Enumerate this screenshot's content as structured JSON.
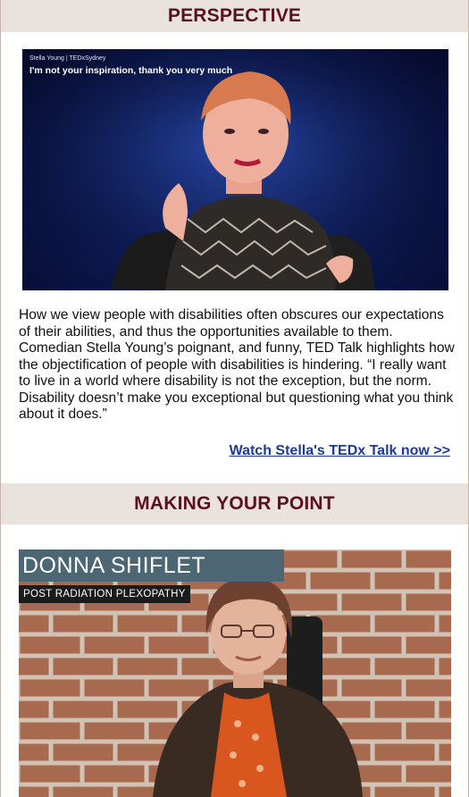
{
  "section1": {
    "title": "PERSPECTIVE",
    "video": {
      "caption_small": "Stella Young | TEDxSydney",
      "caption_big": "I'm not your inspiration, thank you very much"
    },
    "paragraph": "How we view people with disabilities often obscures our expectations of their abilities, and thus the opportunities available to them. Comedian Stella Young’s poignant, and funny, TED Talk highlights how the objectification of people with disabilities is hindering. “I really want to live in a world where disability is not the exception, but the norm. Disability doesn’t make you exceptional but questioning what you think about it does.”",
    "cta_label": "Watch Stella's TEDx Talk now >> "
  },
  "section2": {
    "title": "MAKING YOUR POINT",
    "video": {
      "name": "DONNA SHIFLET",
      "subtitle": "POST RADIATION PLEXOPATHY"
    }
  },
  "colors": {
    "band_bg": "#eae2dc",
    "title_color": "#5b0f22",
    "link_color": "#1f3a93"
  }
}
